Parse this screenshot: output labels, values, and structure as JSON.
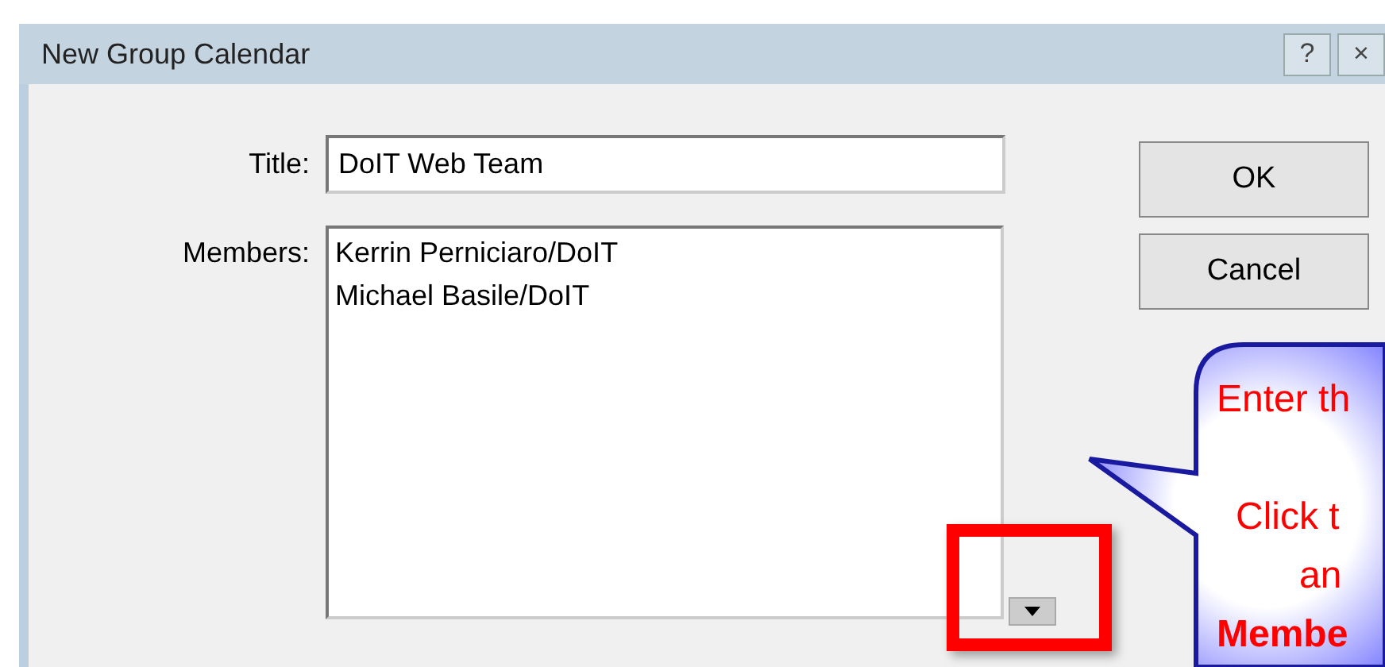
{
  "window": {
    "title": "New Group Calendar",
    "title_buttons": [
      "?",
      "×"
    ]
  },
  "form": {
    "title_label": "Title:",
    "title_value": "DoIT Web Team",
    "members_label": "Members:",
    "members": [
      "Kerrin Perniciaro/DoIT",
      "Michael Basile/DoIT"
    ]
  },
  "buttons": [
    "OK",
    "Cancel"
  ],
  "callout": {
    "lines": [
      {
        "text": "Enter th",
        "bold": false
      },
      {
        "text": "Click t",
        "bold": false
      },
      {
        "text": "an",
        "bold": false
      },
      {
        "text": "Membe",
        "bold": true
      }
    ]
  }
}
